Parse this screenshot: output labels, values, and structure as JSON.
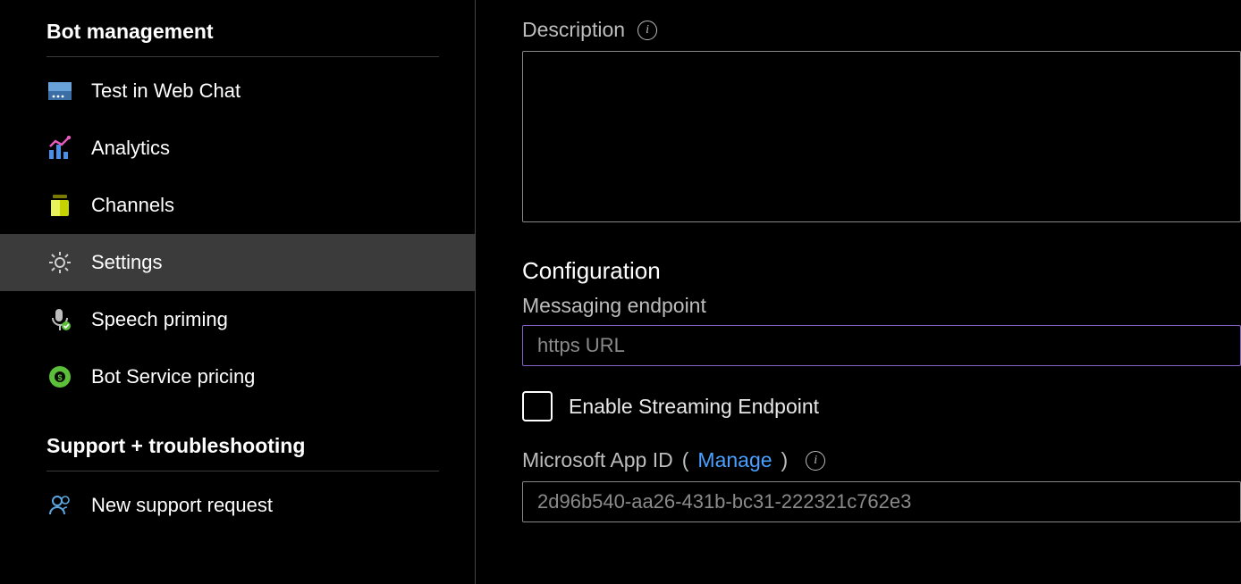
{
  "sidebar": {
    "sections": [
      {
        "title": "Bot management",
        "items": [
          {
            "label": "Test in Web Chat"
          },
          {
            "label": "Analytics"
          },
          {
            "label": "Channels"
          },
          {
            "label": "Settings"
          },
          {
            "label": "Speech priming"
          },
          {
            "label": "Bot Service pricing"
          }
        ]
      },
      {
        "title": "Support + troubleshooting",
        "items": [
          {
            "label": "New support request"
          }
        ]
      }
    ]
  },
  "main": {
    "description_label": "Description",
    "description_value": "",
    "configuration_heading": "Configuration",
    "messaging_endpoint_label": "Messaging endpoint",
    "messaging_endpoint_placeholder": "https URL",
    "messaging_endpoint_value": "",
    "enable_streaming_label": "Enable Streaming Endpoint",
    "enable_streaming_checked": false,
    "app_id_label_prefix": "Microsoft App ID",
    "app_id_manage": "Manage",
    "app_id_value": "2d96b540-aa26-431b-bc31-222321c762e3"
  }
}
